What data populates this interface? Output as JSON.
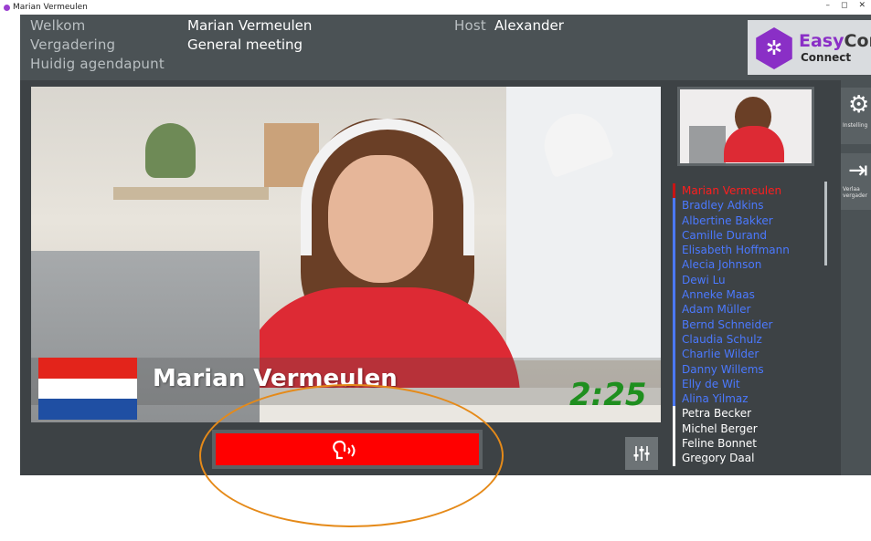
{
  "window": {
    "title": "Marian Vermeulen",
    "controls": [
      "–",
      "◻",
      "✕"
    ]
  },
  "header": {
    "welkom_label": "Welkom",
    "welkom_value": "Marian Vermeulen",
    "vergadering_label": "Vergadering",
    "vergadering_value": "General meeting",
    "agendapunt_label": "Huidig agendapunt",
    "host_label": "Host",
    "host_value": "Alexander"
  },
  "logo": {
    "name_part1": "Easy",
    "name_part2": "Conf",
    "subtitle": "Connect",
    "icon": "network-hexagon-icon"
  },
  "main_video": {
    "speaker_name": "Marian Vermeulen",
    "timer": "2:25",
    "flag_colors": [
      "#e3241b",
      "#ffffff",
      "#1f4fa3"
    ]
  },
  "participants": [
    {
      "name": "Marian Vermeulen",
      "status": "active"
    },
    {
      "name": "Bradley Adkins",
      "status": "queued"
    },
    {
      "name": "Albertine Bakker",
      "status": "queued"
    },
    {
      "name": "Camille Durand",
      "status": "queued"
    },
    {
      "name": "Elisabeth Hoffmann",
      "status": "queued"
    },
    {
      "name": "Alecia Johnson",
      "status": "queued"
    },
    {
      "name": "Dewi Lu",
      "status": "queued"
    },
    {
      "name": "Anneke Maas",
      "status": "queued"
    },
    {
      "name": "Adam Müller",
      "status": "queued"
    },
    {
      "name": "Bernd Schneider",
      "status": "queued"
    },
    {
      "name": "Claudia Schulz",
      "status": "queued"
    },
    {
      "name": "Charlie Wilder",
      "status": "queued"
    },
    {
      "name": "Danny Willems",
      "status": "queued"
    },
    {
      "name": "Elly de Wit",
      "status": "queued"
    },
    {
      "name": "Alina Yilmaz",
      "status": "queued"
    },
    {
      "name": "Petra Becker",
      "status": "idle"
    },
    {
      "name": "Michel Berger",
      "status": "idle"
    },
    {
      "name": "Feline Bonnet",
      "status": "idle"
    },
    {
      "name": "Gregory Daal",
      "status": "idle"
    }
  ],
  "side_buttons": {
    "settings_label": "Instelling",
    "leave_label_1": "Verlaa",
    "leave_label_2": "vergader"
  },
  "controls": {
    "speak_icon": "speaking-head-icon",
    "mixer_icon": "sliders-icon"
  },
  "colors": {
    "active": "#ff1e1e",
    "queued": "#4b79ff",
    "idle": "#ffffff",
    "speak_button": "#ff0000",
    "timer": "#1f8f1f",
    "brand": "#8a2fc6",
    "annotation": "#e58a19"
  }
}
